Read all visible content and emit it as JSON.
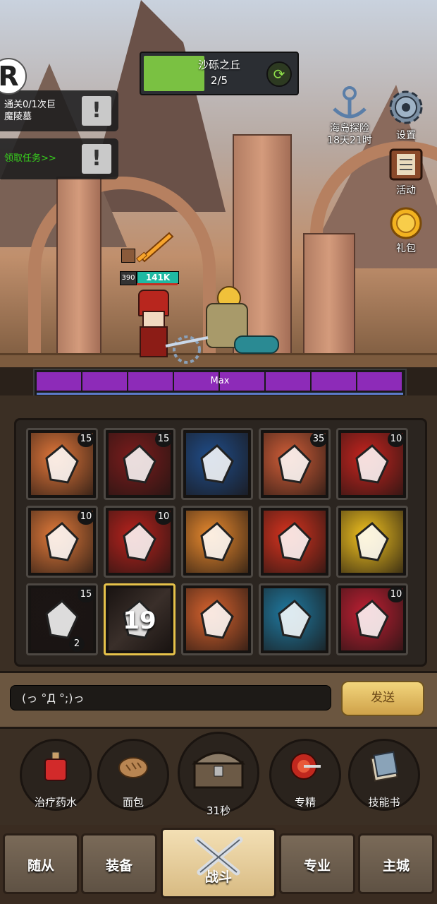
{
  "stage": {
    "name": "沙砾之丘",
    "progress_text": "2/5",
    "progress_fraction": 0.4
  },
  "quests": [
    {
      "text": "通关0/1次巨\n魔陵墓",
      "color": "#ffffff"
    },
    {
      "text": "领取任务>>",
      "color": "#37d21d"
    }
  ],
  "side_icons": {
    "island": {
      "label": "海岛探险",
      "timer": "18天21时"
    },
    "settings": {
      "label": "设置"
    },
    "events": {
      "label": "活动"
    },
    "gift": {
      "label": "礼包"
    }
  },
  "player": {
    "level": "390",
    "hp": "141K"
  },
  "boss_bar": {
    "label": "Max",
    "segments": 8
  },
  "skills": [
    {
      "icon": "white-arrow-skill-icon",
      "color": "#e2773a",
      "count": "15"
    },
    {
      "icon": "axe-strike-skill-icon",
      "color": "#7c1c1c",
      "count": "15"
    },
    {
      "icon": "lightning-axe-skill-icon",
      "color": "#1f4d8a",
      "count": ""
    },
    {
      "icon": "battle-cry-skill-icon",
      "color": "#d25e38",
      "count": "35"
    },
    {
      "icon": "fist-skill-icon",
      "color": "#c7241f",
      "count": "10"
    },
    {
      "icon": "crack-skill-icon",
      "color": "#e27a3a",
      "count": "10"
    },
    {
      "icon": "red-fist-skill-icon",
      "color": "#b8221d",
      "count": "10"
    },
    {
      "icon": "shield-skill-icon",
      "color": "#ea8a2e",
      "count": ""
    },
    {
      "icon": "demon-mask-skill-icon",
      "color": "#d8331f",
      "count": ""
    },
    {
      "icon": "trident-skill-icon",
      "color": "#f2c21f",
      "count": ""
    },
    {
      "icon": "shatter-skill-icon",
      "color": "#1b1514",
      "count": "15",
      "count2": "2"
    },
    {
      "icon": "cooldown-skill-icon",
      "color": "#3a2f2a",
      "count": "",
      "cooldown": "19"
    },
    {
      "icon": "hood-skill-icon",
      "color": "#d8632e",
      "count": ""
    },
    {
      "icon": "banner-skill-icon",
      "color": "#1f7aa1",
      "count": ""
    },
    {
      "icon": "blade-skill-icon",
      "color": "#c01f33",
      "count": "10"
    }
  ],
  "chat": {
    "input_text": "(っ °Д °;)っ",
    "send_label": "发送"
  },
  "items": [
    {
      "label": "治疗药水",
      "icon": "potion-icon"
    },
    {
      "label": "面包",
      "icon": "bread-icon"
    },
    {
      "label": "31秒",
      "icon": "treasure-chest-icon"
    },
    {
      "label": "专精",
      "icon": "target-icon"
    },
    {
      "label": "技能书",
      "icon": "skill-book-icon"
    }
  ],
  "nav": [
    "随从",
    "装备",
    "战斗",
    "专业",
    "主城"
  ]
}
